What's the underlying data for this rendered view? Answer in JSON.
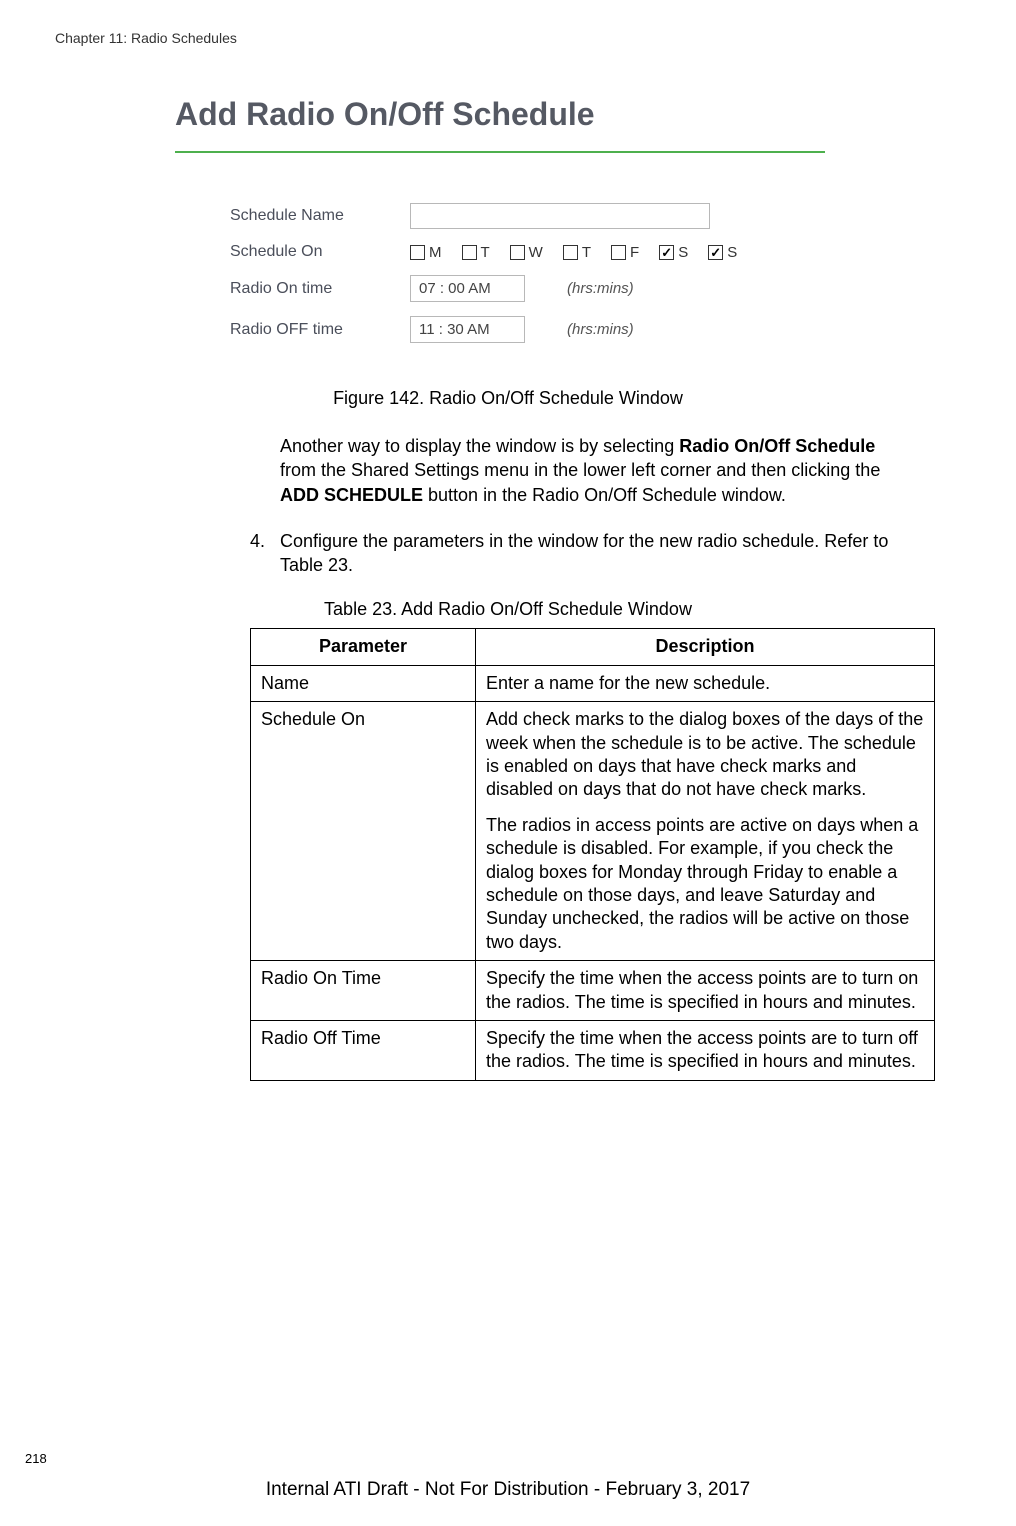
{
  "header": "Chapter 11: Radio Schedules",
  "app_title": "Add Radio On/Off Schedule",
  "form": {
    "name_label": "Schedule Name",
    "schedule_on_label": "Schedule On",
    "radio_on_label": "Radio On time",
    "radio_off_label": "Radio OFF time",
    "days": [
      "M",
      "T",
      "W",
      "T",
      "F",
      "S",
      "S"
    ],
    "days_checked": [
      false,
      false,
      false,
      false,
      false,
      true,
      true
    ],
    "radio_on_value": "07 : 00 AM",
    "radio_off_value": "11 : 30 AM",
    "hrsmins": "(hrs:mins)"
  },
  "figure_caption": "Figure 142. Radio On/Off Schedule Window",
  "para1_pre": "Another way to display the window is by selecting ",
  "para1_bold1": "Radio On/Off Schedule",
  "para1_mid": " from the Shared Settings menu in the lower left corner and then clicking the ",
  "para1_bold2": "ADD SCHEDULE",
  "para1_post": " button in the Radio On/Off Schedule window.",
  "step4_num": "4.",
  "step4_text": "Configure the parameters in the window for the new radio schedule. Refer to Table 23.",
  "table_caption": "Table 23. Add Radio On/Off Schedule Window",
  "table": {
    "th1": "Parameter",
    "th2": "Description",
    "rows": [
      {
        "p": "Name",
        "d1": "Enter a name for the new schedule."
      },
      {
        "p": "Schedule On",
        "d1": "Add check marks to the dialog boxes of the days of the week when the schedule is to be active. The schedule is enabled on days that have check marks and disabled on days that do not have check marks.",
        "d2": "The radios in access points are active on days when a schedule is disabled. For example, if you check the dialog boxes for Monday through Friday to enable a schedule on those days, and leave Saturday and Sunday unchecked, the radios will be active on those two days."
      },
      {
        "p": "Radio On Time",
        "d1": "Specify the time when the access points are to turn on the radios. The time is specified in hours and minutes."
      },
      {
        "p": "Radio Off Time",
        "d1": "Specify the time when the access points are to turn off the radios. The time is specified in hours and minutes."
      }
    ]
  },
  "page_num": "218",
  "footer": "Internal ATI Draft - Not For Distribution - February 3, 2017"
}
